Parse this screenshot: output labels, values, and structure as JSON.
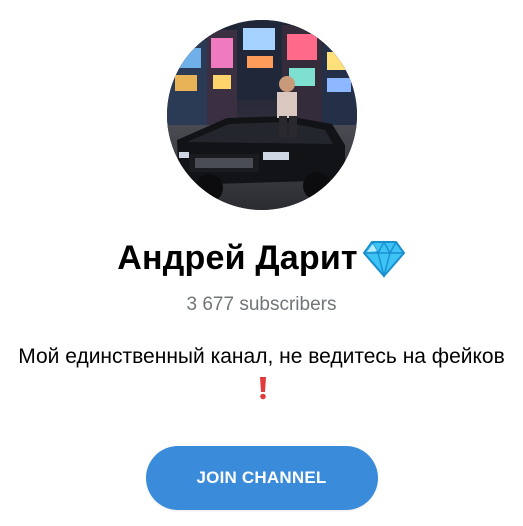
{
  "channel": {
    "title": "Андрей Дарит",
    "title_badge_icon": "diamond-gem-icon",
    "subscribers": "3 677 subscribers",
    "description": "Мой единственный канал, не ведитесь на фейков",
    "description_end_icon": "red-exclamation-icon",
    "avatar_icon": "channel-avatar-photo"
  },
  "actions": {
    "join_label": "JOIN CHANNEL"
  },
  "colors": {
    "accent": "#3a8bd9",
    "muted_text": "#707579",
    "gem": "#3ec3f5",
    "exclamation": "#e23b3b"
  }
}
